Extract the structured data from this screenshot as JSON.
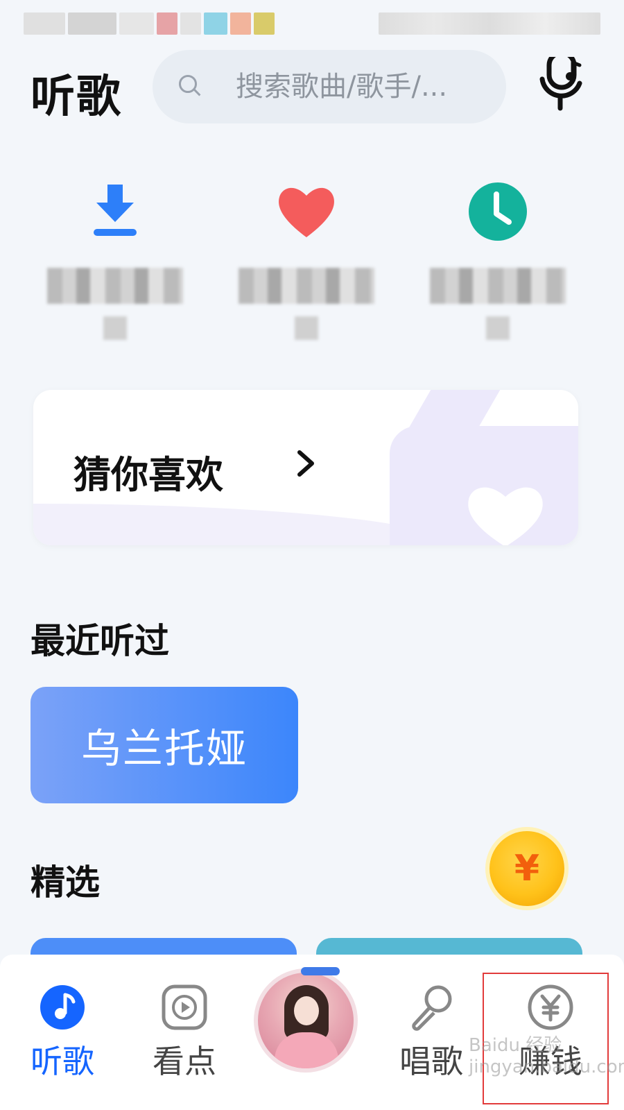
{
  "header": {
    "title": "听歌",
    "search_placeholder": "搜索歌曲/歌手/...",
    "mic_icon": "singing-mic-icon"
  },
  "shortcuts": [
    {
      "icon": "download-icon",
      "color": "#2d7ff9"
    },
    {
      "icon": "heart-icon",
      "color": "#f45c5c"
    },
    {
      "icon": "clock-icon",
      "color": "#14b29c"
    }
  ],
  "guess_card": {
    "label": "猜你喜欢"
  },
  "recent": {
    "title": "最近听过",
    "items": [
      "乌兰托娅"
    ]
  },
  "featured": {
    "title": "精选",
    "coin_symbol": "¥"
  },
  "tabs": [
    {
      "label": "听歌",
      "icon": "music-note-icon",
      "active": true
    },
    {
      "label": "看点",
      "icon": "play-icon",
      "active": false
    },
    {
      "label": "",
      "icon": "avatar",
      "active": false
    },
    {
      "label": "唱歌",
      "icon": "microphone-icon",
      "active": false
    },
    {
      "label": "赚钱",
      "icon": "yuan-coin-icon",
      "active": false
    }
  ],
  "colors": {
    "accent": "#1565ff",
    "background": "#f3f6fa"
  },
  "watermark": "Baidu 经验 jingyan.baidu.com"
}
